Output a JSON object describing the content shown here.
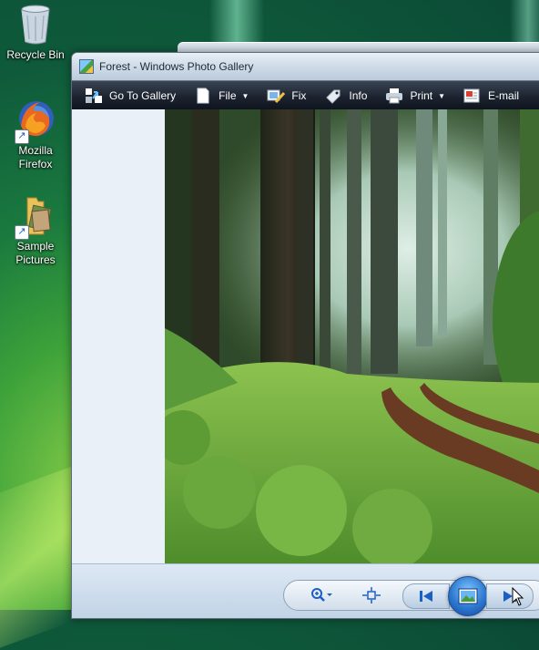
{
  "desktop": {
    "icons": [
      {
        "label": "Recycle Bin"
      },
      {
        "label_line1": "Mozilla",
        "label_line2": "Firefox"
      },
      {
        "label_line1": "Sample",
        "label_line2": "Pictures"
      }
    ]
  },
  "window": {
    "title": "Forest - Windows Photo Gallery"
  },
  "toolbar": {
    "go_to_gallery": "Go To Gallery",
    "file": "File",
    "fix": "Fix",
    "info": "Info",
    "print": "Print",
    "email": "E-mail"
  },
  "photo": {
    "subject": "forest path"
  },
  "colors": {
    "toolbar_bg": "#1c2330",
    "accent_blue": "#1c5fc4",
    "desktop_green": "#1a7a3e"
  }
}
